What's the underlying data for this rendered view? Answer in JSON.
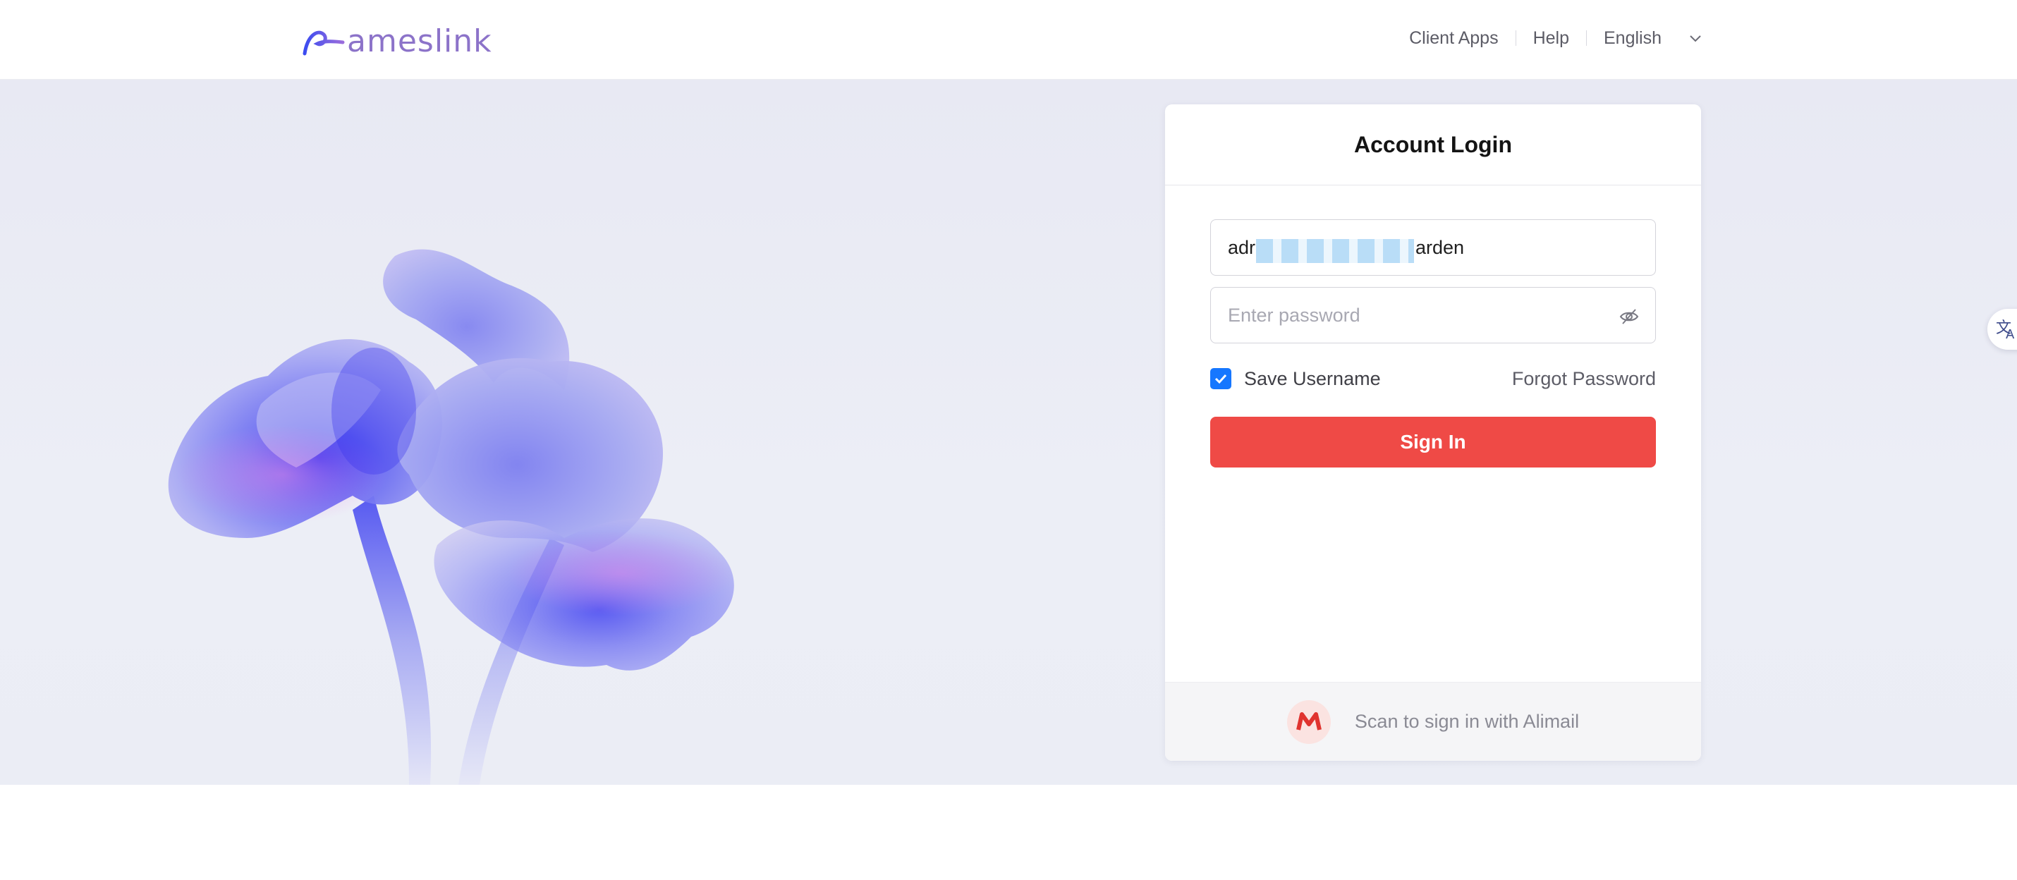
{
  "header": {
    "logo_text": "ameslink",
    "nav": {
      "client_apps": "Client Apps",
      "help": "Help",
      "language": "English"
    }
  },
  "login": {
    "title": "Account Login",
    "username_visible_prefix": "adr",
    "username_visible_suffix": "arden",
    "password_placeholder": "Enter password",
    "save_username_label": "Save Username",
    "save_username_checked": true,
    "forgot_password": "Forgot Password",
    "signin_button": "Sign In",
    "alimail_scan": "Scan to sign in with Alimail"
  },
  "icons": {
    "logo": "ameslink-logo-icon",
    "language_chevron": "chevron-down-icon",
    "password_visibility": "eye-off-icon",
    "checkbox": "checkmark-icon",
    "alimail": "alimail-m-icon",
    "translate": "translate-icon"
  },
  "colors": {
    "accent_blue": "#1677ff",
    "signin_red": "#ef4a46",
    "logo_purple": "#8c73c9",
    "hero_background": "#e9eaf4"
  }
}
